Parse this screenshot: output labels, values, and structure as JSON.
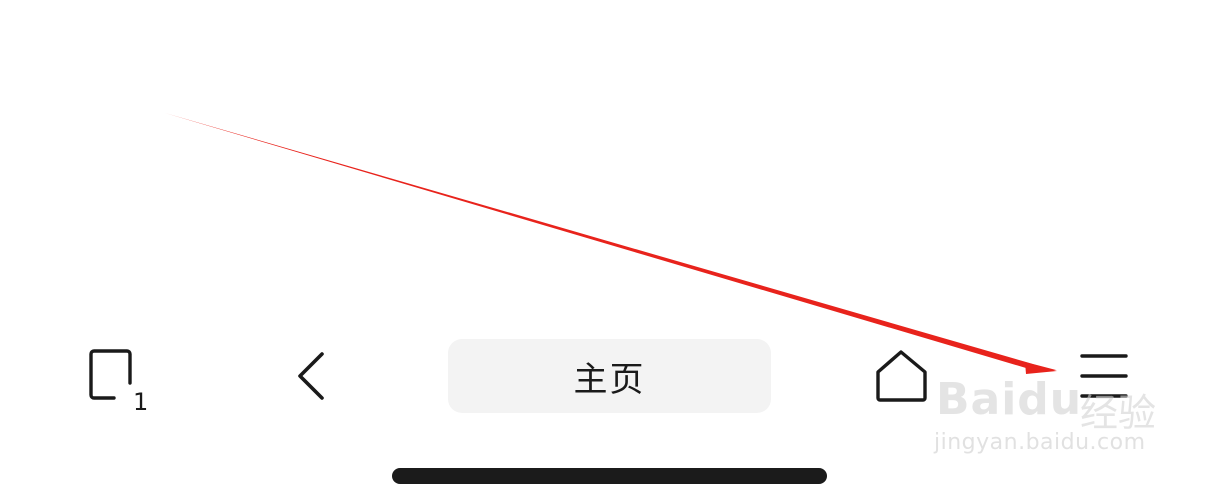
{
  "toolbar": {
    "tabs_count": "1",
    "home_pill_label": "主页",
    "icons": {
      "tabs": "tabs-icon",
      "back": "chevron-left-icon",
      "home": "house-icon",
      "menu": "hamburger-menu-icon"
    }
  },
  "watermark": {
    "logo_text": "Baidu",
    "cn_text": "经验",
    "url_text": "jingyan.baidu.com"
  },
  "colors": {
    "background": "#ffffff",
    "icon": "#1a1a1a",
    "pill_bg": "#f3f3f3",
    "annotation": "#e8231c",
    "home_indicator": "#1b1b1b"
  }
}
